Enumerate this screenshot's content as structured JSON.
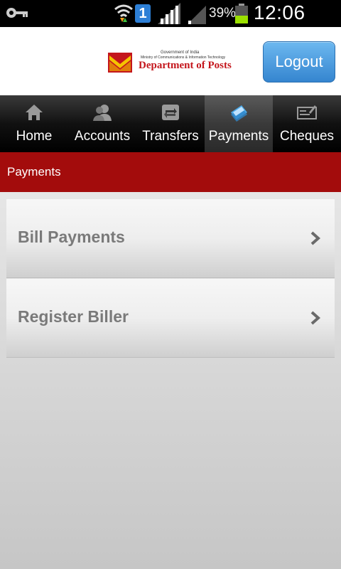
{
  "status_bar": {
    "notification_count": "1",
    "battery_percent": "39%",
    "time": "12:06 PM",
    "icons": [
      "key-icon",
      "wifi-icon",
      "notification-icon",
      "signal-icon",
      "signal-weak-icon",
      "battery-icon"
    ]
  },
  "header": {
    "logo": {
      "gov_text": "Government of India",
      "ministry_text": "Ministry of Communications & Information Technology",
      "dept_text": "Department of Posts"
    },
    "logout_label": "Logout"
  },
  "tabs": [
    {
      "label": "Home",
      "icon": "home-icon",
      "active": false
    },
    {
      "label": "Accounts",
      "icon": "accounts-icon",
      "active": false
    },
    {
      "label": "Transfers",
      "icon": "transfers-icon",
      "active": false
    },
    {
      "label": "Payments",
      "icon": "payments-icon",
      "active": true
    },
    {
      "label": "Cheques",
      "icon": "cheques-icon",
      "active": false
    }
  ],
  "section": {
    "title": "Payments"
  },
  "menu_items": [
    {
      "label": "Bill Payments",
      "icon": "chevron-right-icon"
    },
    {
      "label": "Register Biller",
      "icon": "chevron-right-icon"
    }
  ],
  "colors": {
    "section_header": "#a30c0c",
    "logout_button": "#4a9be0",
    "brand_red": "#c4161c"
  }
}
